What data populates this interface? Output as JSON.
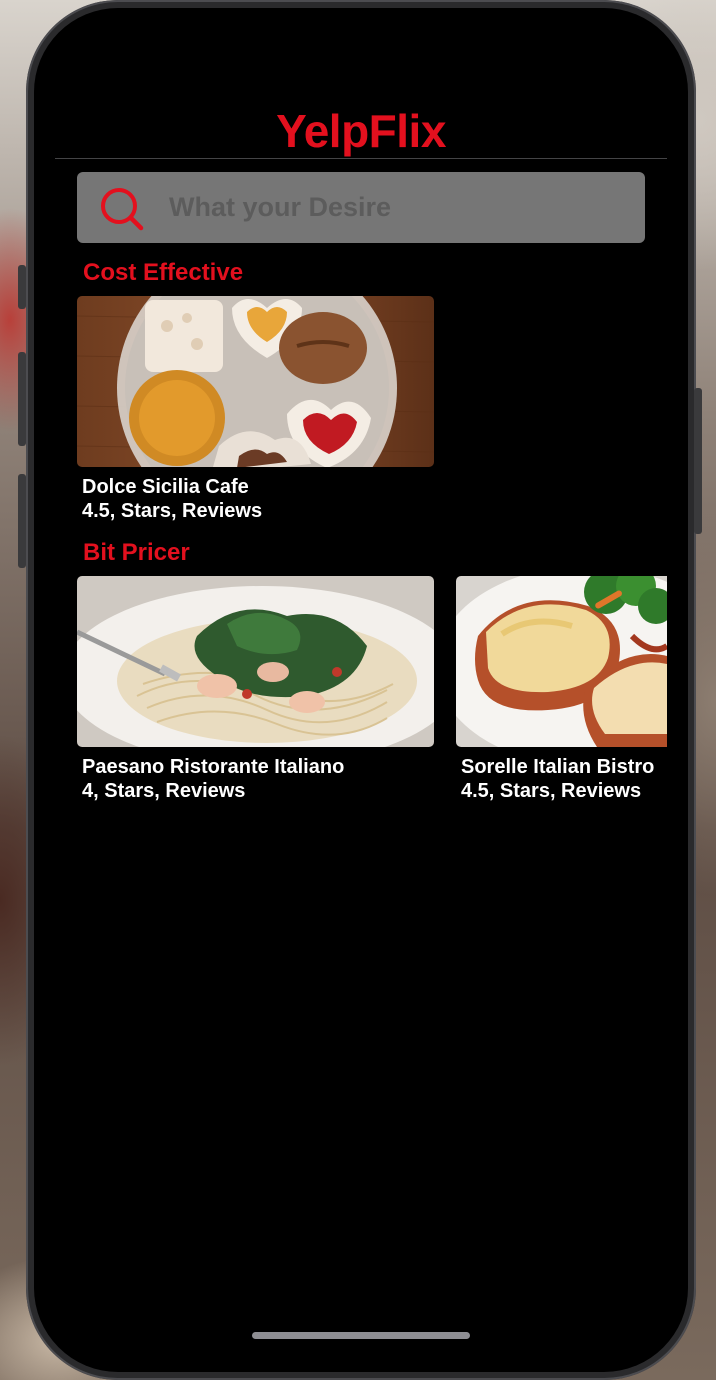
{
  "app": {
    "title": "YelpFlix"
  },
  "search": {
    "placeholder": "What your Desire",
    "value": ""
  },
  "sections": [
    {
      "title": "Cost Effective",
      "items": [
        {
          "name": "Dolce Sicilia Cafe",
          "meta": "4.5, Stars,  Reviews",
          "image": "pastries-photo"
        }
      ]
    },
    {
      "title": "Bit Pricer",
      "items": [
        {
          "name": "Paesano Ristorante Italiano",
          "meta": "4, Stars,  Reviews",
          "image": "pasta-photo"
        },
        {
          "name": "Sorelle Italian Bistro",
          "meta": "4.5, Stars,  Reviews",
          "image": "parmigiana-photo"
        }
      ]
    }
  ],
  "colors": {
    "accent": "#e3101e",
    "background": "#000000",
    "search_bg": "#767676",
    "text": "#ffffff"
  },
  "icons": {
    "search": "search-icon"
  }
}
